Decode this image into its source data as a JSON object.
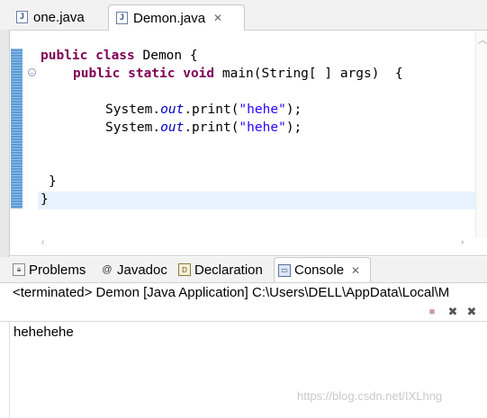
{
  "editor": {
    "tabs": [
      {
        "label": "one.java",
        "icon": "java-file-icon",
        "active": false
      },
      {
        "label": "Demon.java",
        "icon": "java-file-icon",
        "active": true,
        "close_icon": "close-icon"
      }
    ],
    "code": {
      "line1": {
        "kw": "public class",
        "rest": " Demon {"
      },
      "line2": {
        "kw": "public static void",
        "rest": " main(String[ ] args)  {"
      },
      "line3": {
        "pre": "System.",
        "field": "out",
        "mid": ".print(",
        "str": "\"hehe\"",
        "post": ");"
      },
      "line4": {
        "pre": "System.",
        "field": "out",
        "mid": ".print(",
        "str": "\"hehe\"",
        "post": ");"
      },
      "line5": "}",
      "line6": "}"
    }
  },
  "views": {
    "tabs": [
      {
        "label": "Problems",
        "icon": "problems-icon"
      },
      {
        "label": "Javadoc",
        "icon": "at-icon"
      },
      {
        "label": "Declaration",
        "icon": "declaration-icon"
      },
      {
        "label": "Console",
        "icon": "console-icon",
        "active": true,
        "close_icon": "close-icon"
      }
    ]
  },
  "console": {
    "header": "<terminated> Demon [Java Application] C:\\Users\\DELL\\AppData\\Local\\M",
    "output": "hehehehe",
    "toolbar": [
      "terminate-icon",
      "remove-launch-icon",
      "remove-all-icon"
    ]
  },
  "watermark": "https://blog.csdn.net/IXLhng",
  "colors": {
    "keyword": "#7f0055",
    "field": "#0000c0",
    "string": "#2a00ff",
    "ruler": "#5b9bd5",
    "current_line": "#e8f2fe"
  }
}
